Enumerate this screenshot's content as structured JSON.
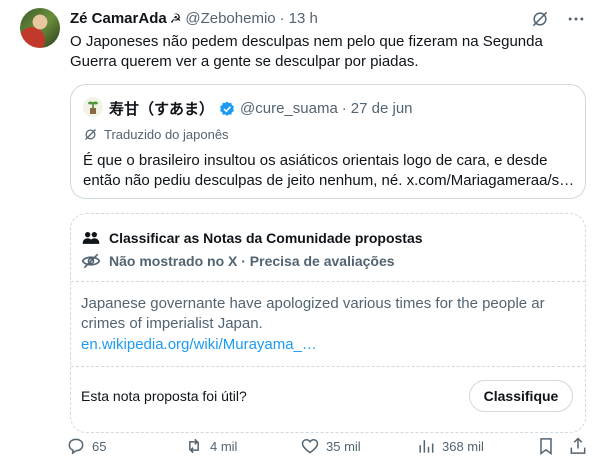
{
  "tweet": {
    "author_name": "Zé CamarAda",
    "author_emoji": "☭",
    "handle": "@Zebohemio",
    "separator": "·",
    "time": "13 h",
    "text": "O Japoneses não pedem desculpas nem pelo que fizeram na Segunda Guerra querem ver a gente se desculpar por piadas."
  },
  "quote": {
    "author_name": "寿甘（すあま）",
    "handle": "@cure_suama",
    "separator": "·",
    "date": "27 de jun",
    "translated_label": "Traduzido do japonês",
    "text": "É que o brasileiro insultou os asiáticos orientais logo de cara, e desde então não pediu desculpas de jeito nenhum, né. x.com/Mariagamerаа/s…"
  },
  "community_notes": {
    "title": "Classificar as Notas da Comunidade propostas",
    "status": "Não mostrado no X · Precisa de avaliações",
    "note_text": "Japanese governante have apologized various times for the people ar crimes of imperialist Japan.",
    "note_link": "en.wikipedia.org/wiki/Murayama_…",
    "question": "Esta nota proposta foi útil?",
    "rate_button": "Classifique"
  },
  "actions": {
    "replies": "65",
    "reposts": "4 mil",
    "likes": "35 mil",
    "views": "368 mil"
  },
  "colors": {
    "text_primary": "#0f1419",
    "text_secondary": "#536471",
    "link": "#1d9bf0",
    "border": "#cfd9de",
    "verified": "#1d9bf0"
  }
}
